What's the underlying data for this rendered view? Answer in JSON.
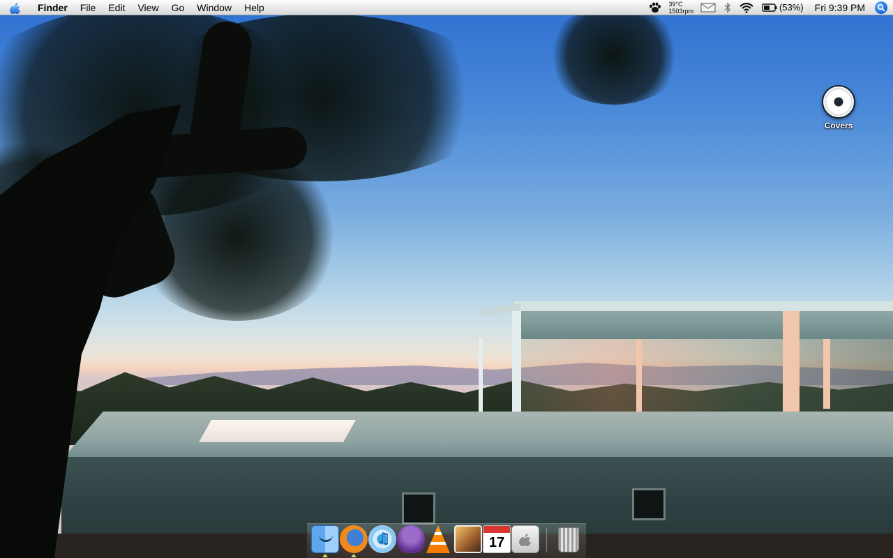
{
  "menubar": {
    "apple_icon": "apple-logo-icon",
    "app_name": "Finder",
    "menus": [
      "File",
      "Edit",
      "View",
      "Go",
      "Window",
      "Help"
    ],
    "status": {
      "temperature": "39°C",
      "fan_speed": "1503rpm",
      "battery_percent": "(53%)",
      "clock": "Fri 9:39 PM"
    }
  },
  "desktop": {
    "icons": [
      {
        "label": "Covers",
        "icon": "disc-icon"
      }
    ]
  },
  "dock": {
    "items": [
      {
        "name": "finder",
        "icon": "finder-icon",
        "running": true
      },
      {
        "name": "firefox",
        "icon": "firefox-icon",
        "running": true
      },
      {
        "name": "itunes",
        "icon": "itunes-icon",
        "running": false
      },
      {
        "name": "adium",
        "icon": "adium-icon",
        "running": false
      },
      {
        "name": "vlc",
        "icon": "vlc-icon",
        "running": false
      },
      {
        "name": "iphoto",
        "icon": "iphoto-icon",
        "running": false
      },
      {
        "name": "ical",
        "icon": "calendar-icon",
        "running": false,
        "calendar_day": "17"
      },
      {
        "name": "system-preferences",
        "icon": "system-preferences-icon",
        "running": false
      },
      {
        "name": "trash",
        "icon": "trash-icon",
        "running": false
      }
    ],
    "running_indicator_color": "#c7e36b"
  },
  "colors": {
    "menubar_top": "#fdfdfd",
    "menubar_bottom": "#d9d9d9",
    "spotlight_blue": "#1363d8"
  }
}
